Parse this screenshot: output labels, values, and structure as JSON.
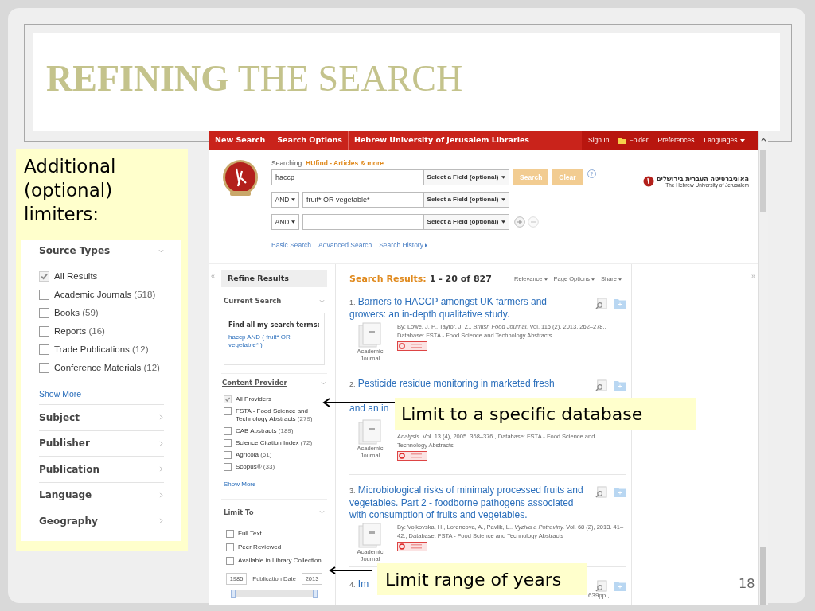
{
  "slide": {
    "title": "**REFINING** THE SEARCH",
    "page_number": "18"
  },
  "limiters_callout": {
    "text": "Additional (optional) limiters:",
    "source_types": {
      "heading": "Source Types",
      "expanded": true,
      "items": [
        {
          "label": "All Results",
          "checked": true
        },
        {
          "label": "Academic Journals",
          "count": "(518)",
          "checked": false
        },
        {
          "label": "Books",
          "count": "(59)",
          "checked": false
        },
        {
          "label": "Reports",
          "count": "(16)",
          "checked": false
        },
        {
          "label": "Trade Publications",
          "count": "(12)",
          "checked": false
        },
        {
          "label": "Conference Materials",
          "count": "(12)",
          "checked": false
        }
      ],
      "show_more": "Show More"
    },
    "sections": [
      {
        "label": "Subject",
        "expanded": false
      },
      {
        "label": "Publisher",
        "expanded": false
      },
      {
        "label": "Publication",
        "expanded": false
      },
      {
        "label": "Language",
        "expanded": false
      },
      {
        "label": "Geography",
        "expanded": false
      }
    ]
  },
  "toolbar": {
    "left": [
      "New Search",
      "Search Options",
      "Hebrew University of Jerusalem Libraries"
    ],
    "right": [
      {
        "label": "Sign In",
        "kind": "plain"
      },
      {
        "label": "Folder",
        "kind": "folder"
      },
      {
        "label": "Preferences",
        "kind": "plain"
      },
      {
        "label": "Languages",
        "kind": "menu"
      }
    ]
  },
  "search": {
    "searching_label": "Searching:",
    "database": "HUfind - Articles & more",
    "rows": [
      {
        "value": "haccp",
        "field": "Select a Field (optional)"
      },
      {
        "operator": "AND",
        "value": "fruit* OR vegetable*",
        "field": "Select a Field (optional)"
      },
      {
        "operator": "AND",
        "field": "Select a Field (optional)"
      }
    ],
    "buttons": [
      {
        "label": "Search",
        "disabled": true
      },
      {
        "label": "Clear",
        "disabled": true
      }
    ],
    "help": "?",
    "links": [
      {
        "label": "Basic Search",
        "kind": "plain"
      },
      {
        "label": "Advanced Search",
        "kind": "plain"
      },
      {
        "label": "Search History",
        "kind": "menu"
      }
    ],
    "university": {
      "hebrew": "האוניברסיטה העברית בירושלים",
      "english": "The Hebrew University of Jerusalem"
    }
  },
  "refine": {
    "collapse": "«",
    "title": "Refine Results",
    "current_search": {
      "heading": "Current Search",
      "box_heading": "Find all my search terms:",
      "query": "haccp AND ( fruit* OR vegetable* )"
    },
    "content_provider": {
      "heading": "Content Provider",
      "items": [
        {
          "label": "All Providers",
          "checked": true
        },
        {
          "label": "FSTA - Food Science and Technology Abstracts",
          "count": "(279)",
          "checked": false
        },
        {
          "label": "CAB Abstracts",
          "count": "(189)",
          "checked": false
        },
        {
          "label": "Science Citation Index",
          "count": "(72)",
          "checked": false
        },
        {
          "label": "Agricola",
          "count": "(61)",
          "checked": false
        },
        {
          "label": "Scopus®",
          "count": "(33)",
          "checked": false
        }
      ],
      "show_more": "Show More"
    },
    "limit_to": {
      "heading": "Limit To",
      "items": [
        {
          "label": "Full Text",
          "checked": false
        },
        {
          "label": "Peer Reviewed",
          "checked": false
        },
        {
          "label": "Available in Library Collection",
          "checked": false
        }
      ],
      "date": {
        "from": "1985",
        "label": "Publication Date",
        "to": "2013"
      },
      "slider": {
        "level": 1
      }
    }
  },
  "results": {
    "label": "Search Results:",
    "range": "1 - 20 of 827",
    "options": [
      "Relevance",
      "Page Options",
      "Share"
    ],
    "expand": "»",
    "items": [
      {
        "number": "1.",
        "title": "Barriers to HACCP amongst UK farmers and growers: an in-depth qualitative study.",
        "meta": "By: Lowe, J. P., Taylor, J. Z.. *British Food Journal.* Vol. 115 (2), 2013. 262–278., Database: FSTA - Food Science and Technology Abstracts",
        "type": "Academic Journal",
        "kind": "full"
      },
      {
        "number": "2.",
        "title": "Pesticide residue monitoring in marketed fresh",
        "title_tail": "and an in",
        "meta": "*Analysis.* Vol. 13 (4), 2005. 368–376., Database: FSTA - Food Science and Technology Abstracts",
        "type": "Academic Journal",
        "kind": "covered"
      },
      {
        "number": "3.",
        "title": "Microbiological risks of minimaly processed fruits and vegetables. Part 2 - foodborne pathogens associated with consumption of fruits and vegetables.",
        "meta": "By: Vojkovska, H., Lorencova, A., Pavlik, L.. *Vyziva a Potraviny.* Vol. 68 (2), 2013. 41–42., Database: FSTA - Food Science and Technology Abstracts",
        "type": "Academic Journal",
        "kind": "full"
      },
      {
        "number": "4.",
        "title": "Im",
        "meta": "639pp.,",
        "kind": "cut"
      }
    ]
  },
  "callouts": [
    {
      "text": "Limit to a specific database",
      "kind": "database"
    },
    {
      "text": "Limit range of years",
      "kind": "years"
    }
  ]
}
